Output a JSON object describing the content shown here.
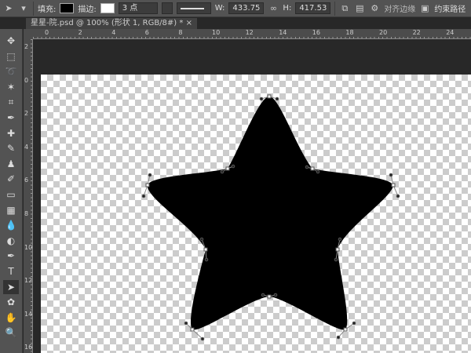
{
  "options": {
    "fill_label": "填充:",
    "stroke_label": "描边:",
    "stroke_width": "3 点",
    "w_label": "W:",
    "w_value": "433.75",
    "h_label": "H:",
    "h_value": "417.53",
    "align_edges": "对齐边缘",
    "constrain_path": "约束路径",
    "fill_color": "#000000",
    "stroke_color": "#ffffff"
  },
  "document_tab": {
    "title": "星星-院.psd @ 100% (形状 1, RGB/8#) *"
  },
  "hruler": [
    "0",
    "2",
    "4",
    "6",
    "8",
    "10",
    "12",
    "14",
    "16",
    "18",
    "20",
    "22",
    "24"
  ],
  "vruler": [
    "2",
    "0",
    "2",
    "4",
    "6",
    "8",
    "10",
    "12",
    "14",
    "16"
  ],
  "tools": [
    "move-tool",
    "marquee-tool",
    "lasso-tool",
    "magic-wand-tool",
    "crop-tool",
    "eyedropper-tool",
    "healing-brush-tool",
    "brush-tool",
    "clone-stamp-tool",
    "history-brush-tool",
    "eraser-tool",
    "gradient-tool",
    "blur-tool",
    "dodge-tool",
    "pen-tool",
    "type-tool",
    "path-selection-tool",
    "custom-shape-tool",
    "hand-tool",
    "zoom-tool"
  ],
  "active_tool": "path-selection-tool"
}
